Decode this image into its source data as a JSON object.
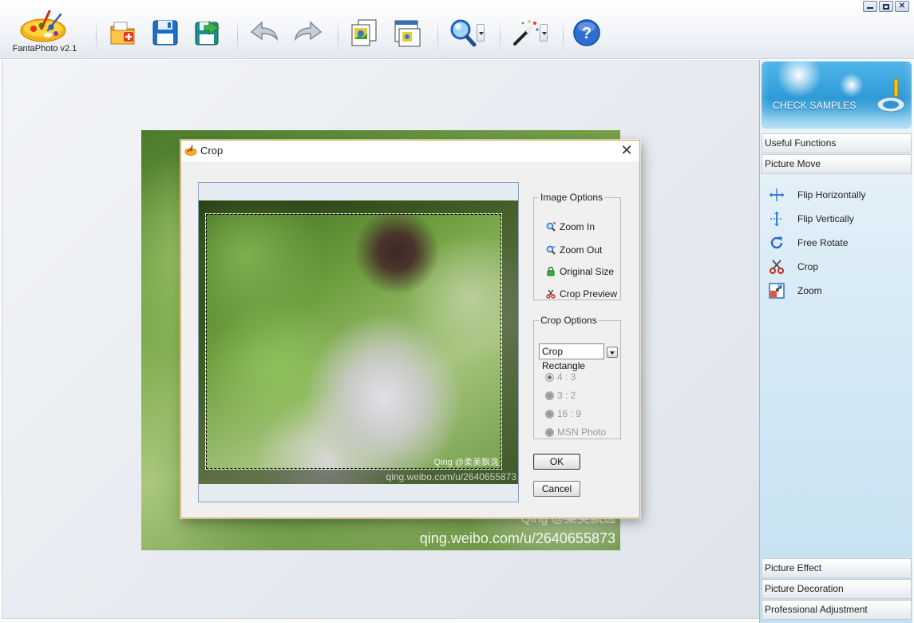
{
  "app": {
    "title": "FantaPhoto v2.1"
  },
  "toolbar": {
    "buttons": [
      {
        "name": "open-file",
        "icon": "open-folder-icon"
      },
      {
        "name": "save",
        "icon": "save-disk-icon"
      },
      {
        "name": "save-as",
        "icon": "export-disk-icon"
      },
      {
        "name": "undo",
        "icon": "undo-arrow-icon"
      },
      {
        "name": "redo",
        "icon": "redo-arrow-icon"
      },
      {
        "name": "batch",
        "icon": "batch-photos-icon"
      },
      {
        "name": "window",
        "icon": "window-view-icon"
      },
      {
        "name": "zoom",
        "icon": "magnifier-icon"
      },
      {
        "name": "magic",
        "icon": "magic-wand-icon"
      },
      {
        "name": "help",
        "icon": "help-icon"
      }
    ]
  },
  "workspace": {
    "watermark_line1": "Qing  @柔美飘逸",
    "watermark_line2": "qing.weibo.com/u/2640655873"
  },
  "sidepanel": {
    "check_samples": "CHECK SAMPLES",
    "sections_top": [
      "Useful Functions",
      "Picture Move"
    ],
    "tools": [
      {
        "label": "Flip  Horizontally",
        "icon": "flip-horizontal-icon"
      },
      {
        "label": "Flip  Vertically",
        "icon": "flip-vertical-icon"
      },
      {
        "label": "Free  Rotate",
        "icon": "rotate-icon"
      },
      {
        "label": "Crop",
        "icon": "crop-scissors-icon"
      },
      {
        "label": "Zoom",
        "icon": "zoom-resize-icon"
      }
    ],
    "sections_bottom": [
      "Picture Effect",
      "Picture Decoration",
      "Professional Adjustment"
    ]
  },
  "dialog": {
    "title": "Crop",
    "close": "✕",
    "preview_watermark_line1": "Qing  @柔美飘逸",
    "preview_watermark_line2": "qing.weibo.com/u/2640655873",
    "image_options": {
      "legend": "Image Options",
      "items": [
        {
          "label": "Zoom In",
          "icon": "zoom-in-icon"
        },
        {
          "label": "Zoom Out",
          "icon": "zoom-out-icon"
        },
        {
          "label": "Original Size",
          "icon": "original-size-icon"
        },
        {
          "label": "Crop Preview",
          "icon": "crop-preview-icon"
        }
      ]
    },
    "crop_options": {
      "legend": "Crop Options",
      "shape_selected": "Crop Rectangle",
      "ratios": [
        {
          "label": "4 : 3",
          "checked": true
        },
        {
          "label": "3 : 2",
          "checked": false
        },
        {
          "label": "16 : 9",
          "checked": false
        },
        {
          "label": "MSN Photo",
          "checked": false
        }
      ]
    },
    "ok_label": "OK",
    "cancel_label": "Cancel"
  },
  "colors": {
    "accent_blue": "#2e9ad6",
    "dialog_border": "#d6a64d"
  }
}
